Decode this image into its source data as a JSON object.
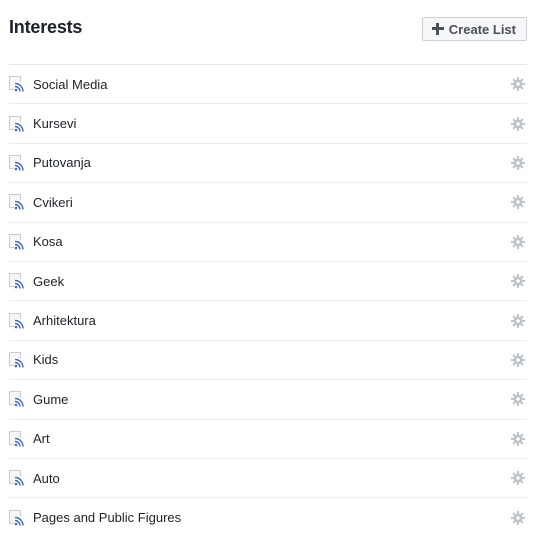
{
  "header": {
    "title": "Interests",
    "create_button_label": "Create List"
  },
  "icons": {
    "create": "plus-icon",
    "list": "interest-list-icon",
    "settings": "gear-icon"
  },
  "colors": {
    "title_text": "#1d2129",
    "button_bg": "#f6f7f9",
    "button_border": "#ccd0d5",
    "feed_blue": "#4267b2",
    "gear_gray": "#bec2c9",
    "divider": "#e9ebee"
  },
  "lists": [
    {
      "label": "Social Media"
    },
    {
      "label": "Kursevi"
    },
    {
      "label": "Putovanja"
    },
    {
      "label": "Cvikeri"
    },
    {
      "label": "Kosa"
    },
    {
      "label": "Geek"
    },
    {
      "label": "Arhitektura"
    },
    {
      "label": "Kids"
    },
    {
      "label": "Gume"
    },
    {
      "label": "Art"
    },
    {
      "label": "Auto"
    },
    {
      "label": "Pages and Public Figures"
    }
  ]
}
